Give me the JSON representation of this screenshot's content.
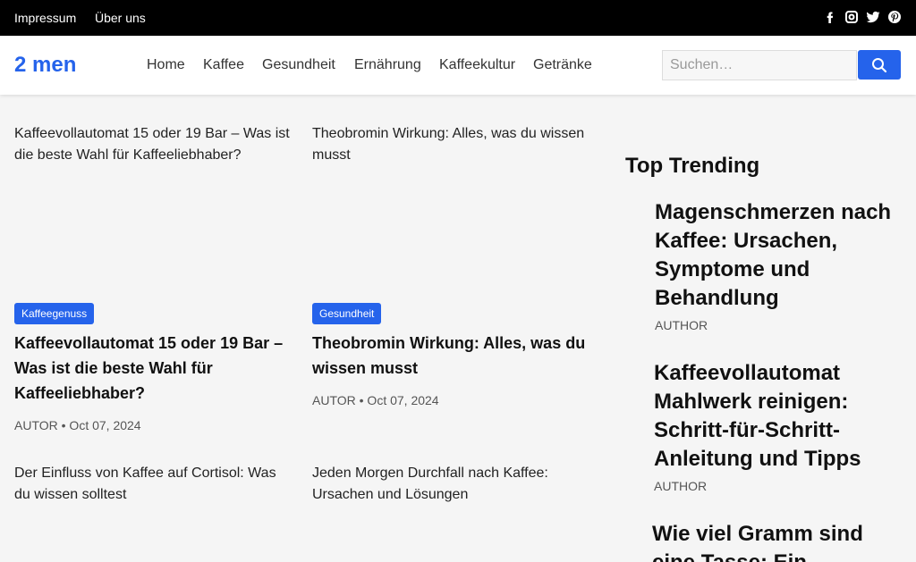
{
  "topbar": {
    "links": [
      "Impressum",
      "Über uns"
    ],
    "social_icons": [
      "facebook-icon",
      "instagram-icon",
      "twitter-icon",
      "pinterest-icon"
    ]
  },
  "header": {
    "logo": "2 men",
    "nav": [
      "Home",
      "Kaffee",
      "Gesundheit",
      "Ernährung",
      "Kaffeekultur",
      "Getränke"
    ],
    "search_placeholder": "Suchen…",
    "search_icon": "search-icon"
  },
  "posts": [
    {
      "image_alt": "Kaffeevollautomat 15 oder 19 Bar – Was ist die beste Wahl für Kaffeeliebhaber?",
      "category": "Kaffeegenuss",
      "title": "Kaffeevollautomat 15 oder 19 Bar – Was ist die beste Wahl für Kaffeeliebhaber?",
      "meta": "AUTOR • Oct 07, 2024"
    },
    {
      "image_alt": "Theobromin Wirkung: Alles, was du wissen musst",
      "category": "Gesundheit",
      "title": "Theobromin Wirkung: Alles, was du wissen musst",
      "meta": "AUTOR • Oct 07, 2024"
    },
    {
      "image_alt": "Der Einfluss von Kaffee auf Cortisol: Was du wissen solltest"
    },
    {
      "image_alt": "Jeden Morgen Durchfall nach Kaffee: Ursachen und Lösungen"
    }
  ],
  "sidebar": {
    "title": "Top Trending",
    "items": [
      {
        "title": "Magenschmerzen nach Kaffee: Ursachen, Symptome und Behandlung",
        "author": "AUTHOR"
      },
      {
        "title": "Kaffeevollautomat Mahlwerk reinigen: Schritt-für-Schritt-Anleitung und Tipps",
        "author": "AUTHOR"
      },
      {
        "title": "Wie viel Gramm sind eine Tasse: Ein"
      }
    ]
  },
  "colors": {
    "accent": "#2563eb",
    "topbar": "#000000",
    "background": "#f5f5f5"
  }
}
